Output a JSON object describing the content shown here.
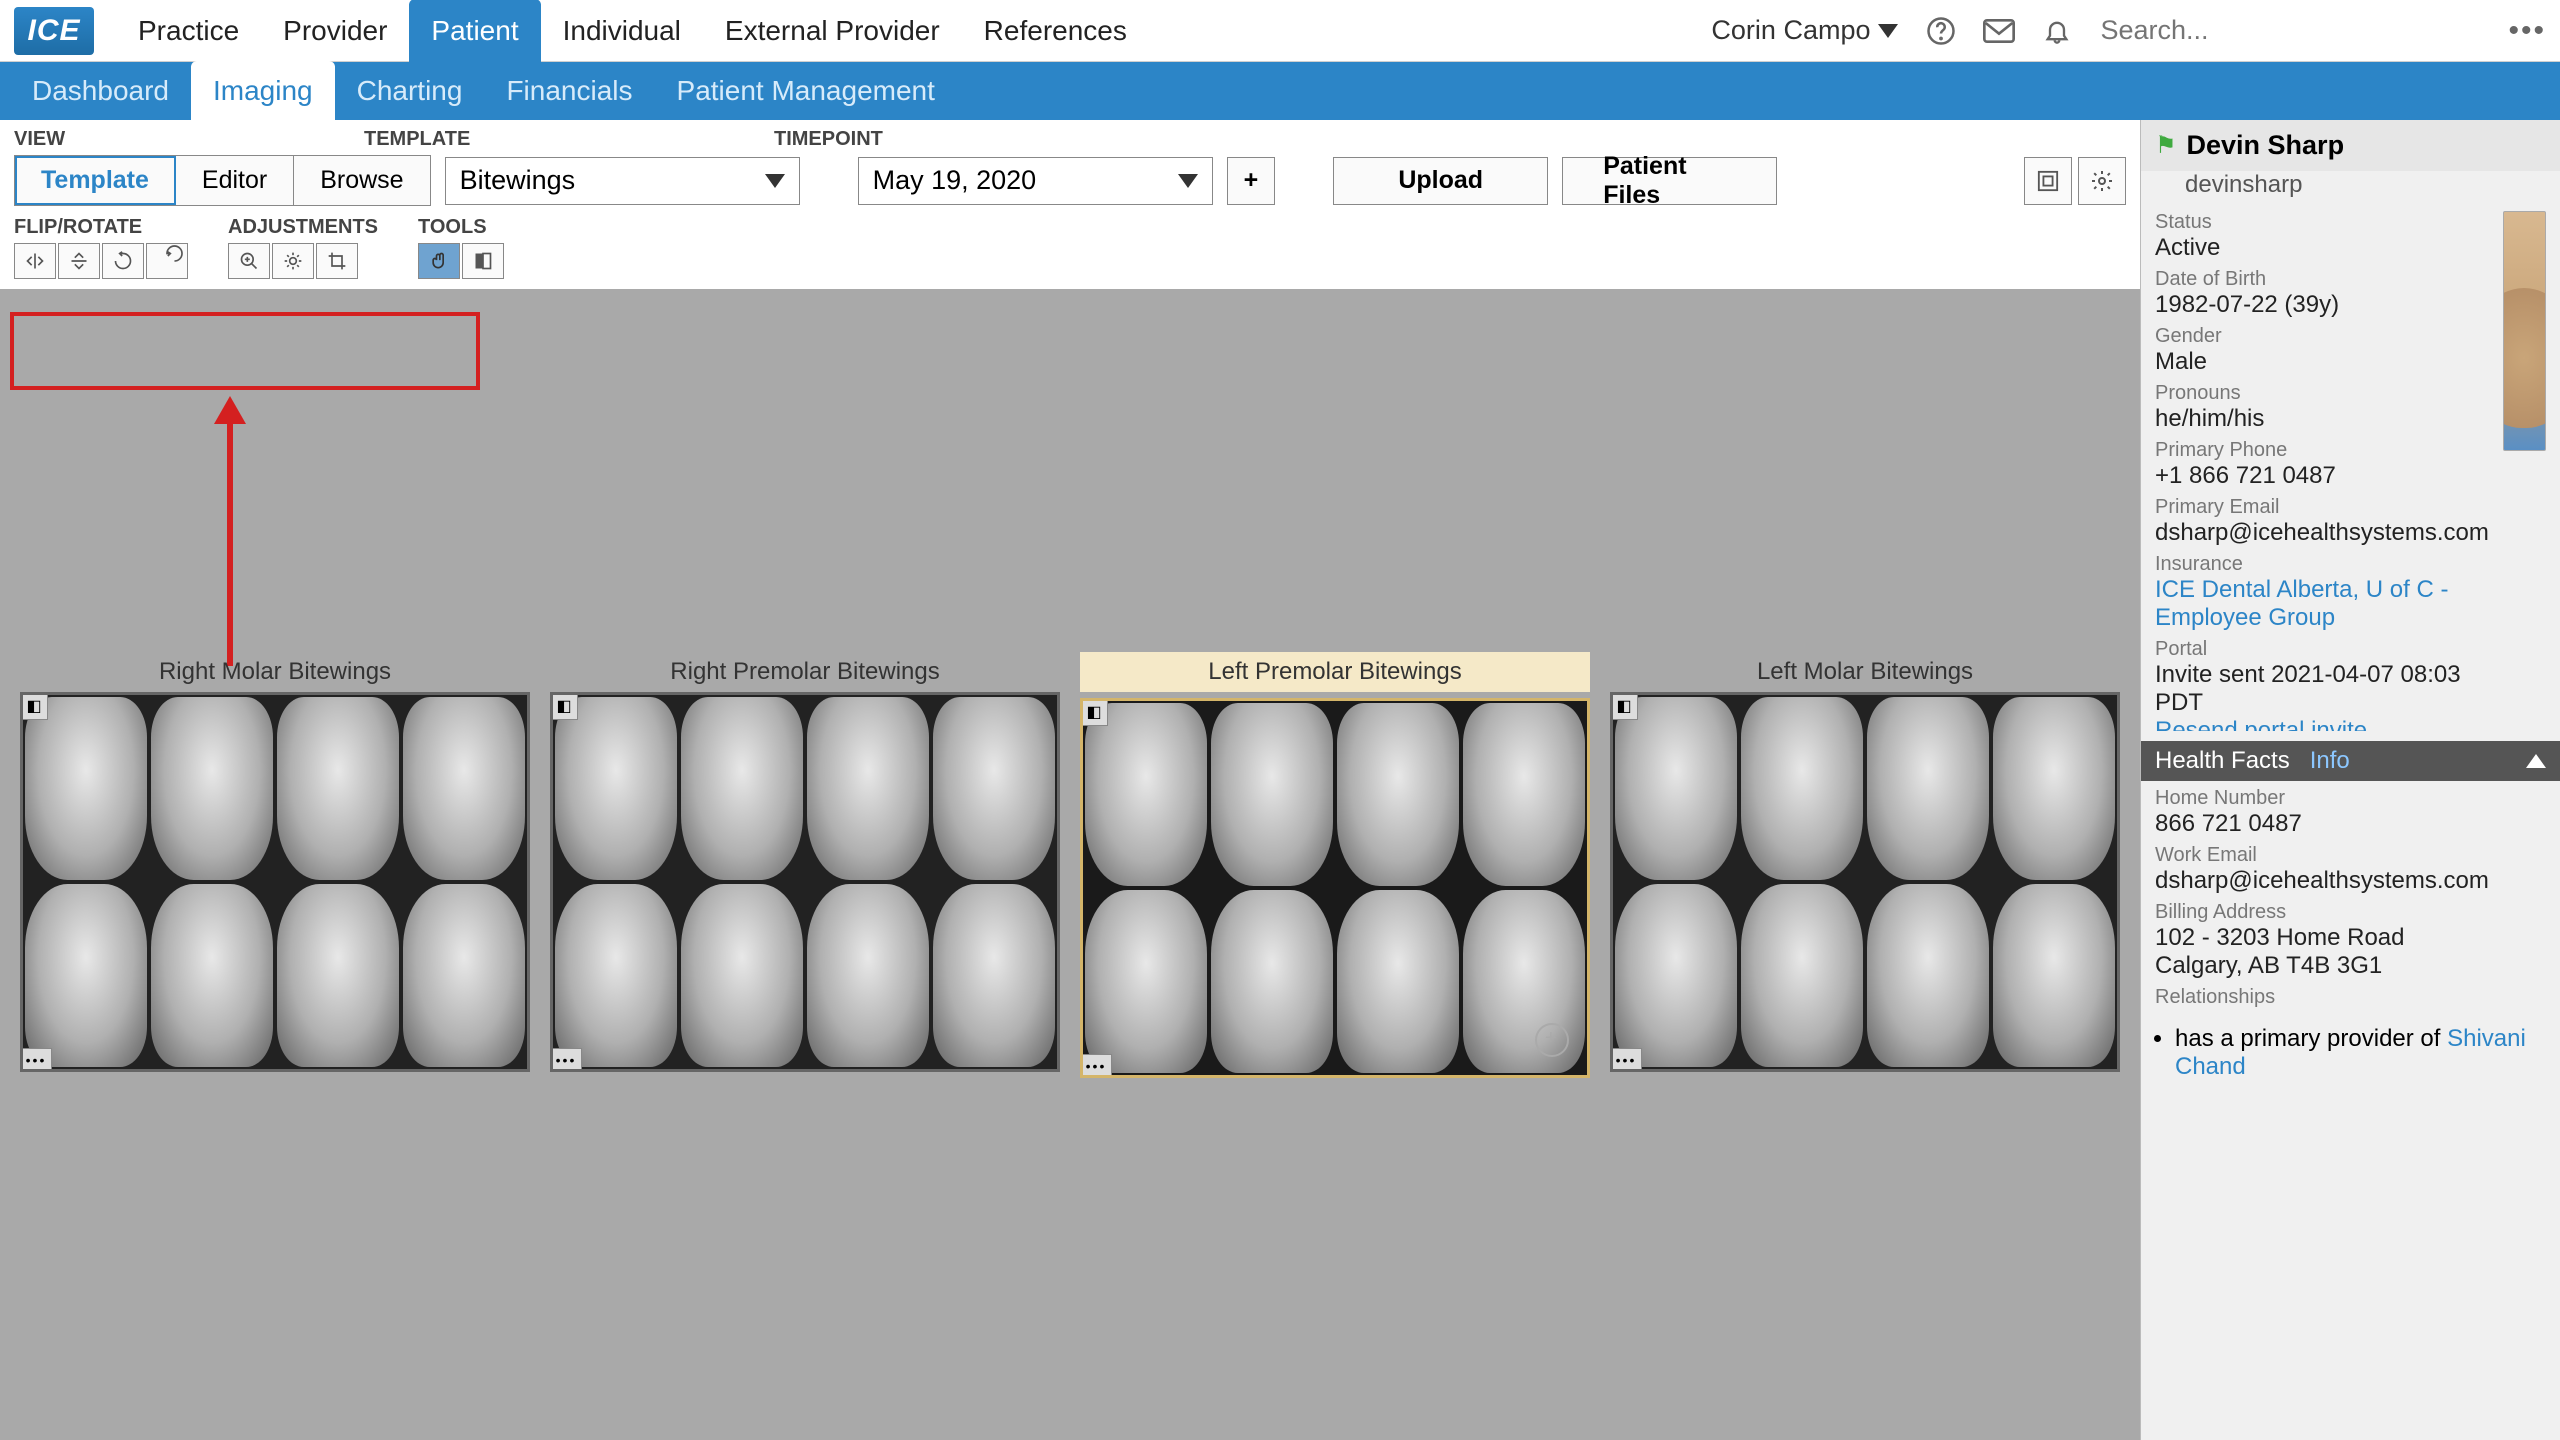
{
  "logo": "ICE",
  "topnav": {
    "items": [
      "Practice",
      "Provider",
      "Patient",
      "Individual",
      "External Provider",
      "References"
    ],
    "activeIndex": 2
  },
  "user": {
    "name": "Corin Campo"
  },
  "search": {
    "placeholder": "Search..."
  },
  "subnav": {
    "items": [
      "Dashboard",
      "Imaging",
      "Charting",
      "Financials",
      "Patient Management"
    ],
    "activeIndex": 1
  },
  "toolbar": {
    "labels": {
      "view": "VIEW",
      "template": "TEMPLATE",
      "timepoint": "TIMEPOINT",
      "flip": "FLIP/ROTATE",
      "adjust": "ADJUSTMENTS",
      "tools": "TOOLS"
    },
    "view": {
      "options": [
        "Template",
        "Editor",
        "Browse"
      ],
      "activeIndex": 0
    },
    "templateSelect": "Bitewings",
    "timepointSelect": "May 19, 2020",
    "addBtn": "+",
    "uploadBtn": "Upload",
    "filesBtn": "Patient Files"
  },
  "xrays": [
    {
      "title": "Right Molar Bitewings",
      "selected": false
    },
    {
      "title": "Right Premolar Bitewings",
      "selected": false
    },
    {
      "title": "Left Premolar Bitewings",
      "selected": true
    },
    {
      "title": "Left Molar Bitewings",
      "selected": false
    }
  ],
  "patient": {
    "name": "Devin Sharp",
    "username": "devinsharp",
    "labels": {
      "status": "Status",
      "dob": "Date of Birth",
      "gender": "Gender",
      "pronouns": "Pronouns",
      "phone": "Primary Phone",
      "email": "Primary Email",
      "insurance": "Insurance",
      "portal": "Portal",
      "home": "Home Number",
      "workEmail": "Work Email",
      "billing": "Billing Address",
      "rel": "Relationships"
    },
    "status": "Active",
    "dob": "1982-07-22 (39y)",
    "gender": "Male",
    "pronouns": "he/him/his",
    "phone": "+1 866 721 0487",
    "email": "dsharp@icehealthsystems.com",
    "insurance": "ICE Dental Alberta, U of C - Employee Group",
    "portal": "Invite sent 2021-04-07 08:03 PDT",
    "portalLink": "Resend portal invite",
    "home": "866 721 0487",
    "workEmail": "dsharp@icehealthsystems.com",
    "billing1": "102 - 3203 Home Road",
    "billing2": "Calgary, AB T4B 3G1",
    "relPrefix": "has a primary provider of ",
    "relLink": "Shivani Chand"
  },
  "healthFacts": {
    "tab1": "Health Facts",
    "tab2": "Info"
  }
}
